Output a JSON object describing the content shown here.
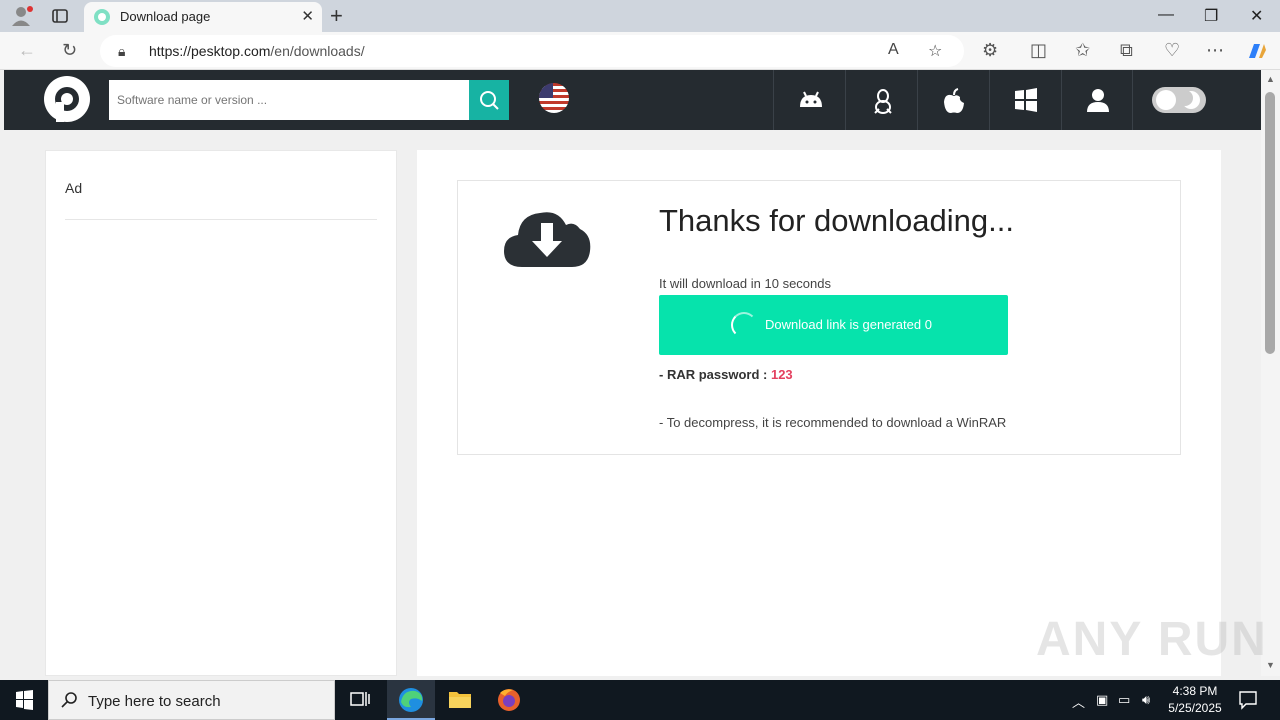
{
  "browser": {
    "tab_title": "Download page",
    "url_host": "https://pesktop.com",
    "url_path": "/en/downloads/"
  },
  "site": {
    "search_placeholder": "Software name or version ...",
    "os_nav": [
      "android-icon",
      "linux-icon",
      "apple-icon",
      "windows-icon",
      "user-icon"
    ],
    "accent": "#17b3a3",
    "header_bg": "#252b30"
  },
  "sidebar": {
    "ad_label": "Ad"
  },
  "download": {
    "heading": "Thanks for downloading...",
    "countdown_text": "It will download in 10 seconds",
    "button_label": "Download link is generated  0",
    "button_color": "#06e3ac",
    "rar_label": "- RAR password : ",
    "rar_password": "123",
    "winrar_note": "- To decompress, it is recommended to download a WinRAR"
  },
  "watermark": "ANY RUN",
  "taskbar": {
    "search_placeholder": "Type here to search",
    "time": "4:38 PM",
    "date": "5/25/2025"
  }
}
